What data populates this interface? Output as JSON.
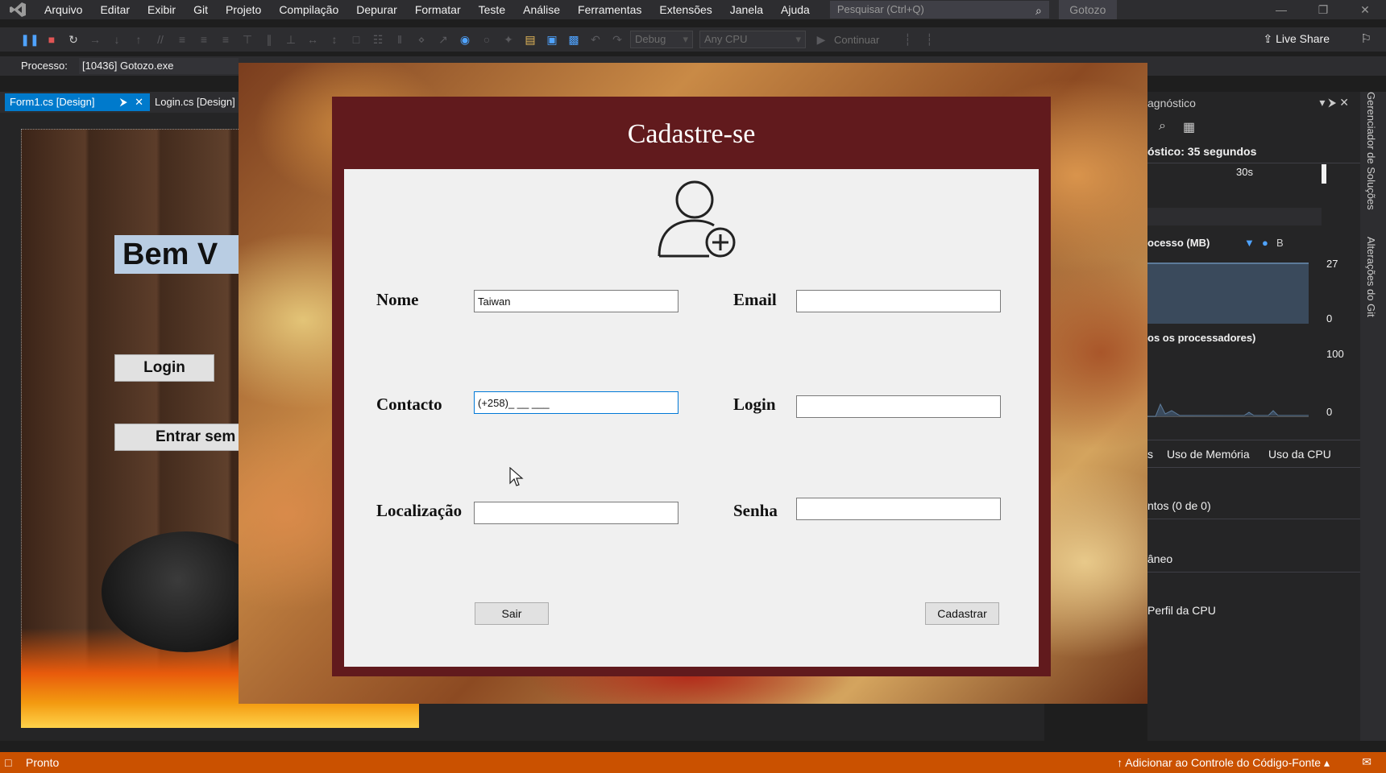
{
  "menubar": {
    "items": [
      "Arquivo",
      "Editar",
      "Exibir",
      "Git",
      "Projeto",
      "Compilação",
      "Depurar",
      "Formatar",
      "Teste",
      "Análise",
      "Ferramentas",
      "Extensões",
      "Janela",
      "Ajuda"
    ],
    "search_placeholder": "Pesquisar (Ctrl+Q)",
    "solution_name": "Gotozo"
  },
  "toolbar": {
    "configuration": "Debug",
    "platform": "Any CPU",
    "continue_label": "Continuar",
    "live_share": "Live Share"
  },
  "process": {
    "label": "Processo:",
    "value": "[10436] Gotozo.exe"
  },
  "tabs": {
    "active": "Form1.cs [Design]",
    "second": "Login.cs [Design]"
  },
  "designer_form": {
    "welcome_text": "Bem V",
    "login_button": "Login",
    "enter_button": "Entrar sem"
  },
  "dialog": {
    "title": "Cadastre-se",
    "fields": {
      "nome_label": "Nome",
      "nome_value": "Taiwan",
      "email_label": "Email",
      "email_value": "",
      "contacto_label": "Contacto",
      "contacto_value": "(+258)_ __ ___",
      "login_label": "Login",
      "login_value": "",
      "localizacao_label": "Localização",
      "localizacao_value": "",
      "senha_label": "Senha",
      "senha_value": ""
    },
    "buttons": {
      "sair": "Sair",
      "cadastrar": "Cadastrar"
    }
  },
  "diagnostics": {
    "title": "agnóstico",
    "session": "óstico: 35 segundos",
    "time_mark": "30s",
    "memory_label": "ocesso (MB)",
    "memory_legend": "B",
    "memory_max": "27",
    "memory_min": "0",
    "cpu_label": "os os processadores)",
    "cpu_max": "100",
    "cpu_min": "0",
    "tab_events": "s",
    "tab_memory": "Uso de Memória",
    "tab_cpu": "Uso da CPU",
    "events_row": "ntos (0 de 0)",
    "instant_row": "âneo",
    "cpu_profile_row": "Perfil da CPU"
  },
  "side_panels": {
    "solution_explorer": "Gerenciador de Soluções",
    "git_changes": "Alterações do Git"
  },
  "statusbar": {
    "ready": "Pronto",
    "source_control": "Adicionar ao Controle do Código-Fonte"
  },
  "colors": {
    "vs_dark": "#2d2d30",
    "accent_blue": "#007acc",
    "status_orange": "#ca5100",
    "dialog_maroon": "#611a1d"
  }
}
